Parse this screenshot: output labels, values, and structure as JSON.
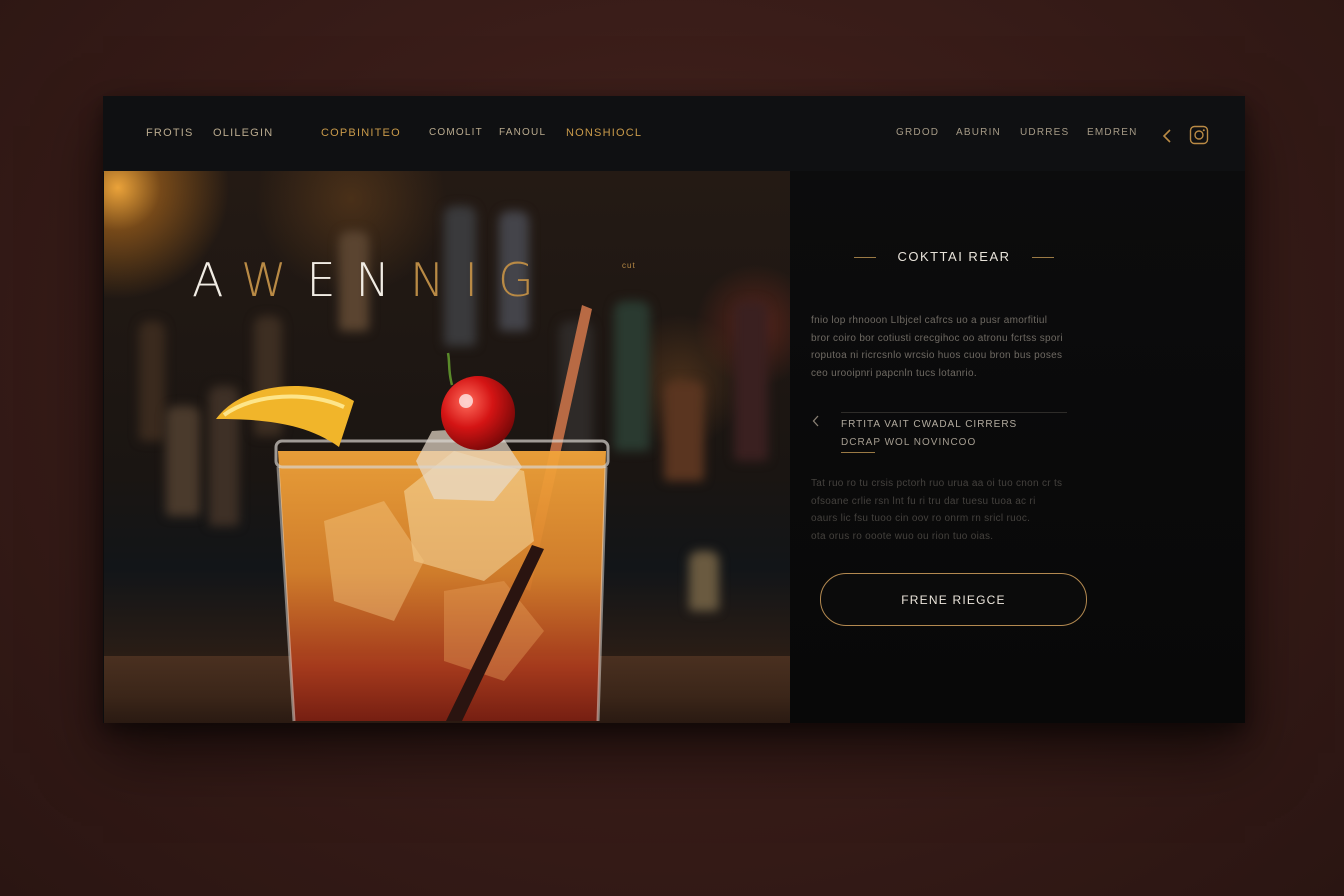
{
  "nav": {
    "left_items": [
      "FROTIS",
      "OLILEGIN",
      "COPBINITEO",
      "COMOLIT",
      "FANOUL",
      "NONSHIOCL"
    ],
    "right_items": [
      "GRDOD",
      "ABURIN",
      "UDRRES",
      "EMDREN"
    ],
    "icons": [
      "chevron-left-icon",
      "instagram-icon"
    ]
  },
  "hero": {
    "title_letters": [
      "A",
      "W",
      "E",
      "N",
      "N",
      "I",
      "G"
    ],
    "title_tag": "cut"
  },
  "panel": {
    "eyebrow": "COKTTAI REAR",
    "intro_lines": [
      "fnio lop rhnooon LIbjcel cafrcs uo a pusr amorfitiul",
      "bror coiro bor cotiusti crecgihoc oo atronu fcrtss spori",
      "roputoa ni ricrcsnlo wrcsio huos cuou bron bus poses",
      "ceo urooipnri papcnln tucs lotanrio."
    ],
    "feature_title": "FRTITA VAIT CWADAL CIRRERS",
    "feature_sub": "DCRAP WOL NOVINCOO",
    "detail_lines": [
      "Tat ruo ro tu crsis pctorh ruo urua aa oi tuo cnon cr ts",
      "ofsoane crlie rsn lnt fu ri tru dar tuesu tuoa ac ri",
      "oaurs lic fsu tuoo cin oov ro onrm rn sricl ruoc.",
      "ota orus ro ooote wuo ou rion tuo oias."
    ],
    "cta_label": "FRENE RIEGCE"
  },
  "colors": {
    "accent_gold": "#b98a45",
    "background": "#3a1d19",
    "card": "#0d0d0e"
  }
}
